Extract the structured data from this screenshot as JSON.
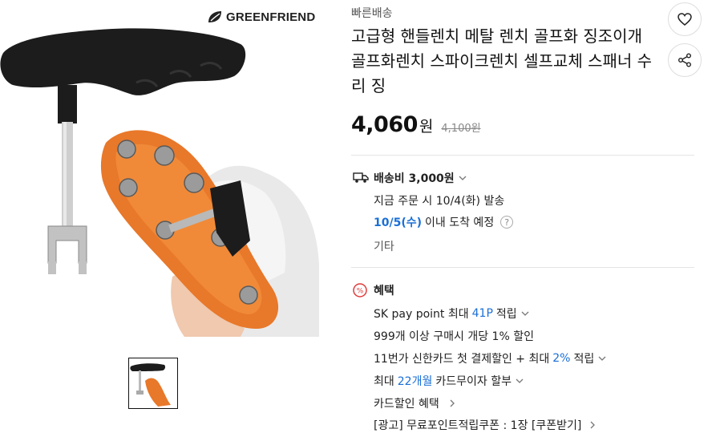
{
  "product": {
    "brand": "GREENFRIEND",
    "shipping_tag": "빠른배송",
    "title": "고급형 핸들렌치 메탈 렌치 골프화 징조이개 골프화렌치 스파이크렌치 셀프교체 스패너 수리 징",
    "price": "4,060",
    "price_unit": "원",
    "original_price": "4,100원"
  },
  "delivery": {
    "fee_label": "배송비 3,000원",
    "order_note": "지금 주문 시 10/4(화) 발송",
    "arrival_date": "10/5(수)",
    "arrival_suffix": "이내 도착 예정",
    "help": "?",
    "etc": "기타"
  },
  "benefits": {
    "title": "혜택",
    "sk_prefix": "SK pay point 최대",
    "sk_points": "41P",
    "sk_suffix": "적립",
    "bulk_discount": "999개 이상 구매시 개당 1% 할인",
    "card_prefix": "11번가 신한카드 첫 결제할인 + 최대",
    "card_rate": "2%",
    "card_suffix": "적립",
    "installment_prefix": "최대",
    "installment_months": "22개월",
    "installment_suffix": "카드무이자 할부",
    "card_discount": "카드할인 혜택",
    "ad_coupon": "[광고] 무료포인트적립쿠폰 : 1장 [쿠폰받기]"
  },
  "colors": {
    "accent_blue": "#1a6fd6",
    "tool_black": "#1c1c1c",
    "sole_orange": "#e8782a"
  },
  "icons": [
    "heart-icon",
    "share-icon",
    "truck-icon",
    "chevron-down-icon",
    "percent-badge-icon",
    "chevron-right-icon"
  ]
}
